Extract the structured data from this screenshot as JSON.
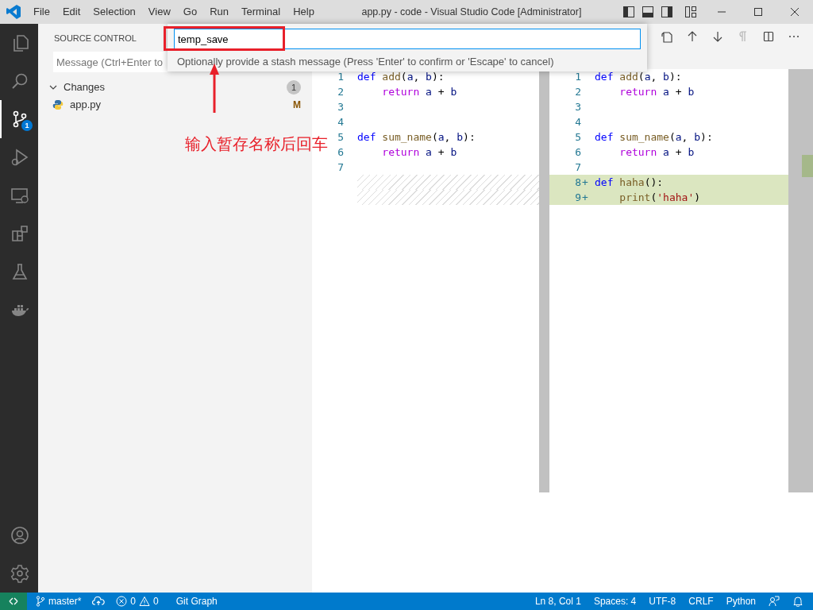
{
  "window": {
    "title": "app.py - code - Visual Studio Code [Administrator]"
  },
  "menu": [
    "File",
    "Edit",
    "Selection",
    "View",
    "Go",
    "Run",
    "Terminal",
    "Help"
  ],
  "activity_bar": {
    "items": [
      {
        "selected": false
      },
      {
        "selected": false
      },
      {
        "selected": true,
        "badge": "1"
      },
      {
        "selected": false
      },
      {
        "selected": false
      },
      {
        "selected": false
      },
      {
        "selected": false
      },
      {
        "selected": false
      }
    ],
    "bottom_items": [
      {
        "selected": false
      },
      {
        "selected": false
      }
    ]
  },
  "sidebar": {
    "title": "SOURCE CONTROL",
    "message_field": {
      "placeholder": "Message (Ctrl+Enter to"
    },
    "section": {
      "label": "Changes",
      "expanded": true,
      "count": "1",
      "files": [
        {
          "name": "app.py",
          "status": "M"
        }
      ]
    }
  },
  "quick_input": {
    "value": "temp_save",
    "hint": "Optionally provide a stash message (Press 'Enter' to confirm or 'Escape' to cancel)"
  },
  "annotation": {
    "text": "输入暂存名称后回车"
  },
  "editor_toolbar": [
    {
      "disabled": false
    },
    {
      "disabled": false
    },
    {
      "disabled": false
    },
    {
      "disabled": true
    },
    {
      "disabled": false
    },
    {
      "disabled": false
    }
  ],
  "diff": {
    "left": [
      {
        "kind": "normal",
        "number": "1",
        "tokens": [
          {
            "text": "def ",
            "kind": "keyword"
          },
          {
            "text": "add",
            "kind": "function"
          },
          {
            "text": "(",
            "kind": "plain"
          },
          {
            "text": "a",
            "kind": "variable"
          },
          {
            "text": ", ",
            "kind": "plain"
          },
          {
            "text": "b",
            "kind": "variable"
          },
          {
            "text": "):",
            "kind": "plain"
          }
        ]
      },
      {
        "kind": "normal",
        "number": "2",
        "tokens": [
          {
            "text": "    return ",
            "kind": "control"
          },
          {
            "text": "a",
            "kind": "variable"
          },
          {
            "text": " + ",
            "kind": "plain"
          },
          {
            "text": "b",
            "kind": "variable"
          }
        ]
      },
      {
        "kind": "normal",
        "number": "3"
      },
      {
        "kind": "normal",
        "number": "4"
      },
      {
        "kind": "normal",
        "number": "5",
        "tokens": [
          {
            "text": "def ",
            "kind": "keyword"
          },
          {
            "text": "sum_name",
            "kind": "function"
          },
          {
            "text": "(",
            "kind": "plain"
          },
          {
            "text": "a",
            "kind": "variable"
          },
          {
            "text": ", ",
            "kind": "plain"
          },
          {
            "text": "b",
            "kind": "variable"
          },
          {
            "text": "):",
            "kind": "plain"
          }
        ]
      },
      {
        "kind": "normal",
        "number": "6",
        "tokens": [
          {
            "text": "    return ",
            "kind": "control"
          },
          {
            "text": "a",
            "kind": "variable"
          },
          {
            "text": " + ",
            "kind": "plain"
          },
          {
            "text": "b",
            "kind": "variable"
          }
        ]
      },
      {
        "kind": "normal",
        "number": "7"
      },
      {
        "kind": "filler"
      },
      {
        "kind": "filler"
      }
    ],
    "right": [
      {
        "kind": "normal",
        "number": "1",
        "tokens": [
          {
            "text": "def ",
            "kind": "keyword"
          },
          {
            "text": "add",
            "kind": "function"
          },
          {
            "text": "(",
            "kind": "plain"
          },
          {
            "text": "a",
            "kind": "variable"
          },
          {
            "text": ", ",
            "kind": "plain"
          },
          {
            "text": "b",
            "kind": "variable"
          },
          {
            "text": "):",
            "kind": "plain"
          }
        ]
      },
      {
        "kind": "normal",
        "number": "2",
        "tokens": [
          {
            "text": "    return ",
            "kind": "control"
          },
          {
            "text": "a",
            "kind": "variable"
          },
          {
            "text": " + ",
            "kind": "plain"
          },
          {
            "text": "b",
            "kind": "variable"
          }
        ]
      },
      {
        "kind": "normal",
        "number": "3"
      },
      {
        "kind": "normal",
        "number": "4"
      },
      {
        "kind": "normal",
        "number": "5",
        "tokens": [
          {
            "text": "def ",
            "kind": "keyword"
          },
          {
            "text": "sum_name",
            "kind": "function"
          },
          {
            "text": "(",
            "kind": "plain"
          },
          {
            "text": "a",
            "kind": "variable"
          },
          {
            "text": ", ",
            "kind": "plain"
          },
          {
            "text": "b",
            "kind": "variable"
          },
          {
            "text": "):",
            "kind": "plain"
          }
        ]
      },
      {
        "kind": "normal",
        "number": "6",
        "tokens": [
          {
            "text": "    return ",
            "kind": "control"
          },
          {
            "text": "a",
            "kind": "variable"
          },
          {
            "text": " + ",
            "kind": "plain"
          },
          {
            "text": "b",
            "kind": "variable"
          }
        ]
      },
      {
        "kind": "normal",
        "number": "7"
      },
      {
        "kind": "added",
        "number": "8",
        "marker": "+",
        "tokens": [
          {
            "text": "def ",
            "kind": "keyword"
          },
          {
            "text": "haha",
            "kind": "function"
          },
          {
            "text": "():",
            "kind": "plain"
          }
        ]
      },
      {
        "kind": "added",
        "number": "9",
        "marker": "+",
        "tokens": [
          {
            "text": "    print",
            "kind": "function"
          },
          {
            "text": "(",
            "kind": "plain"
          },
          {
            "text": "'haha'",
            "kind": "string"
          },
          {
            "text": ")",
            "kind": "plain"
          }
        ]
      }
    ]
  },
  "status_bar": {
    "branch": "master*",
    "errors": "0",
    "warnings": "0",
    "git_graph": "Git Graph",
    "right": [
      "Ln 8, Col 1",
      "Spaces: 4",
      "UTF-8",
      "CRLF",
      "Python"
    ]
  }
}
